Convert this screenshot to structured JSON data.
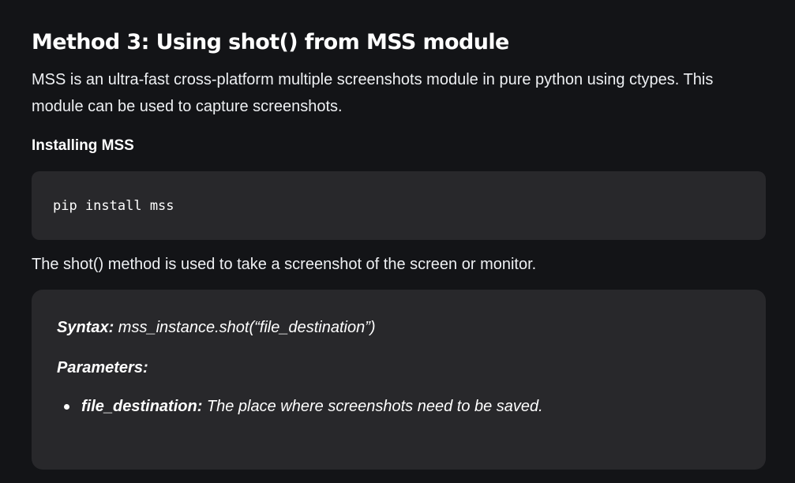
{
  "heading": "Method 3: Using shot()  from MSS module",
  "intro": "MSS is an ultra-fast cross-platform multiple screenshots module in pure python using ctypes. This module can be used to capture screenshots.",
  "subheading": "Installing MSS",
  "code": "pip install mss",
  "description": "The shot() method is used to take a screenshot of the screen or monitor.",
  "syntax": {
    "label": "Syntax:",
    "value": " mss_instance.shot(“file_destination”)"
  },
  "parameters": {
    "label": "Parameters:",
    "items": [
      {
        "name": "file_destination:",
        "description": " The place where screenshots need to be saved."
      }
    ]
  }
}
